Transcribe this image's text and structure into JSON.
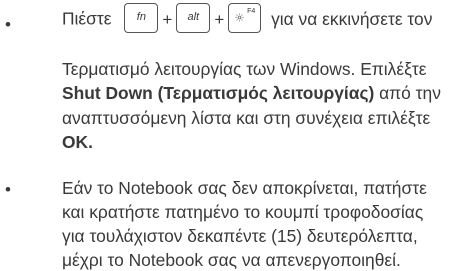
{
  "bullets": [
    "•",
    "•"
  ],
  "item1": {
    "line1_prefix": "Πιέστε",
    "key_fn": "fn",
    "plus1": "+",
    "key_alt": "alt",
    "plus2": "+",
    "key_f4_label": "F4",
    "line1_suffix": "για να εκκινήσετε τον",
    "line2": "Τερματισμό λειτουργίας των Windows. Επιλέξτε",
    "line3_bold": "Shut Down (Τερματισμός λειτουργίας)",
    "line3_rest": " από την",
    "line4": "αναπτυσσόμενη λίστα και στη συνέχεια επιλέξτε",
    "line5_bold": "OK."
  },
  "item2": {
    "line1": "Εάν το Notebook σας δεν αποκρίνεται, πατήστε",
    "line2": "και κρατήστε πατημένο το κουμπί τροφοδοσίας",
    "line3": "για τουλάχιστον δεκαπέντε (15) δευτερόλεπτα,",
    "line4": "μέχρι το Notebook σας να απενεργοποιηθεί."
  }
}
